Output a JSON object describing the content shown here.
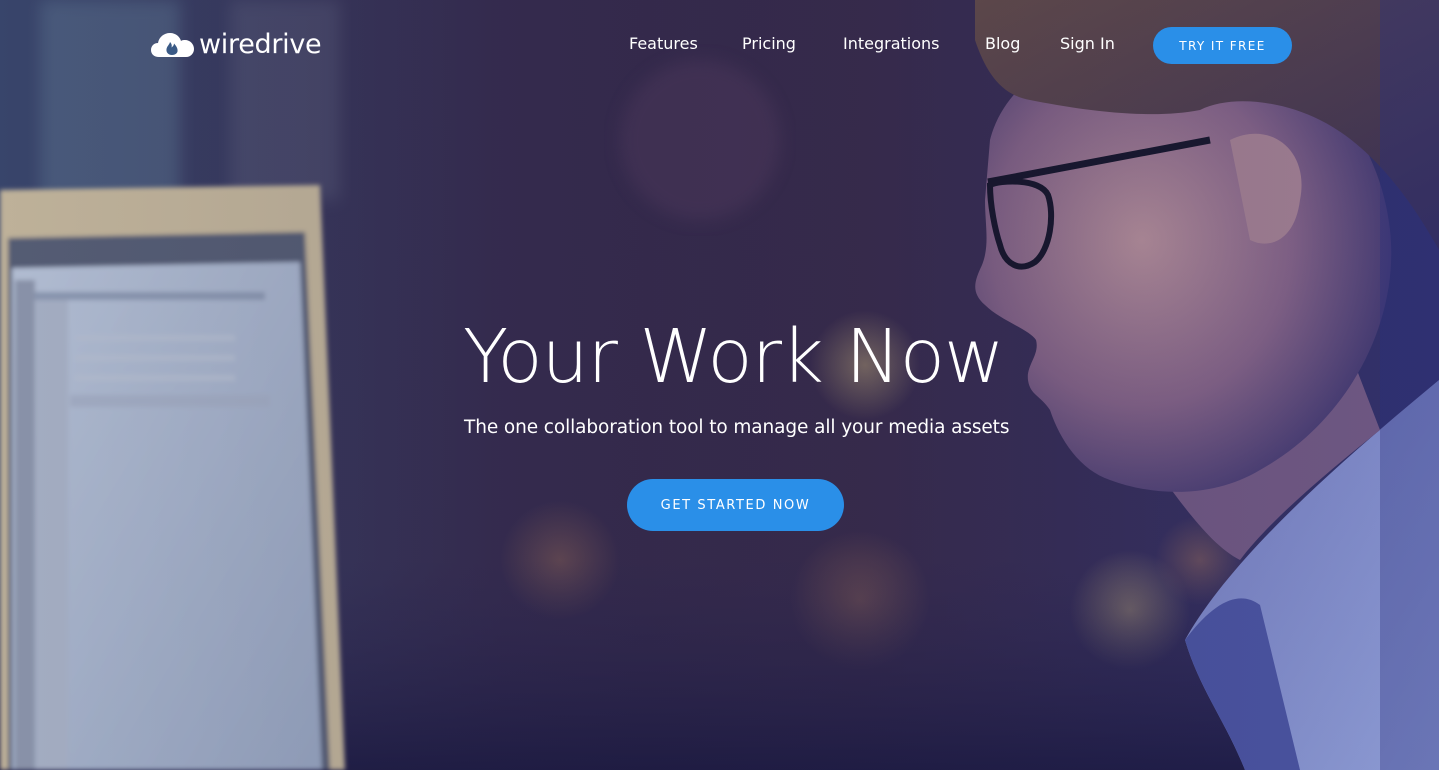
{
  "brand": {
    "logo_text": "wiredrive",
    "logo_icon": "cloud-flame-icon",
    "accent_color": "#2a8fe8"
  },
  "nav": {
    "items": [
      {
        "label": "Features"
      },
      {
        "label": "Pricing"
      },
      {
        "label": "Integrations"
      },
      {
        "label": "Blog"
      },
      {
        "label": "Sign In"
      }
    ],
    "cta_label": "TRY IT FREE"
  },
  "hero": {
    "headline": "Your Work Now",
    "subheadline": "The one collaboration tool to manage all your media assets",
    "cta_label": "GET STARTED NOW",
    "background_image": "photo of man with glasses looking at a computer monitor"
  }
}
